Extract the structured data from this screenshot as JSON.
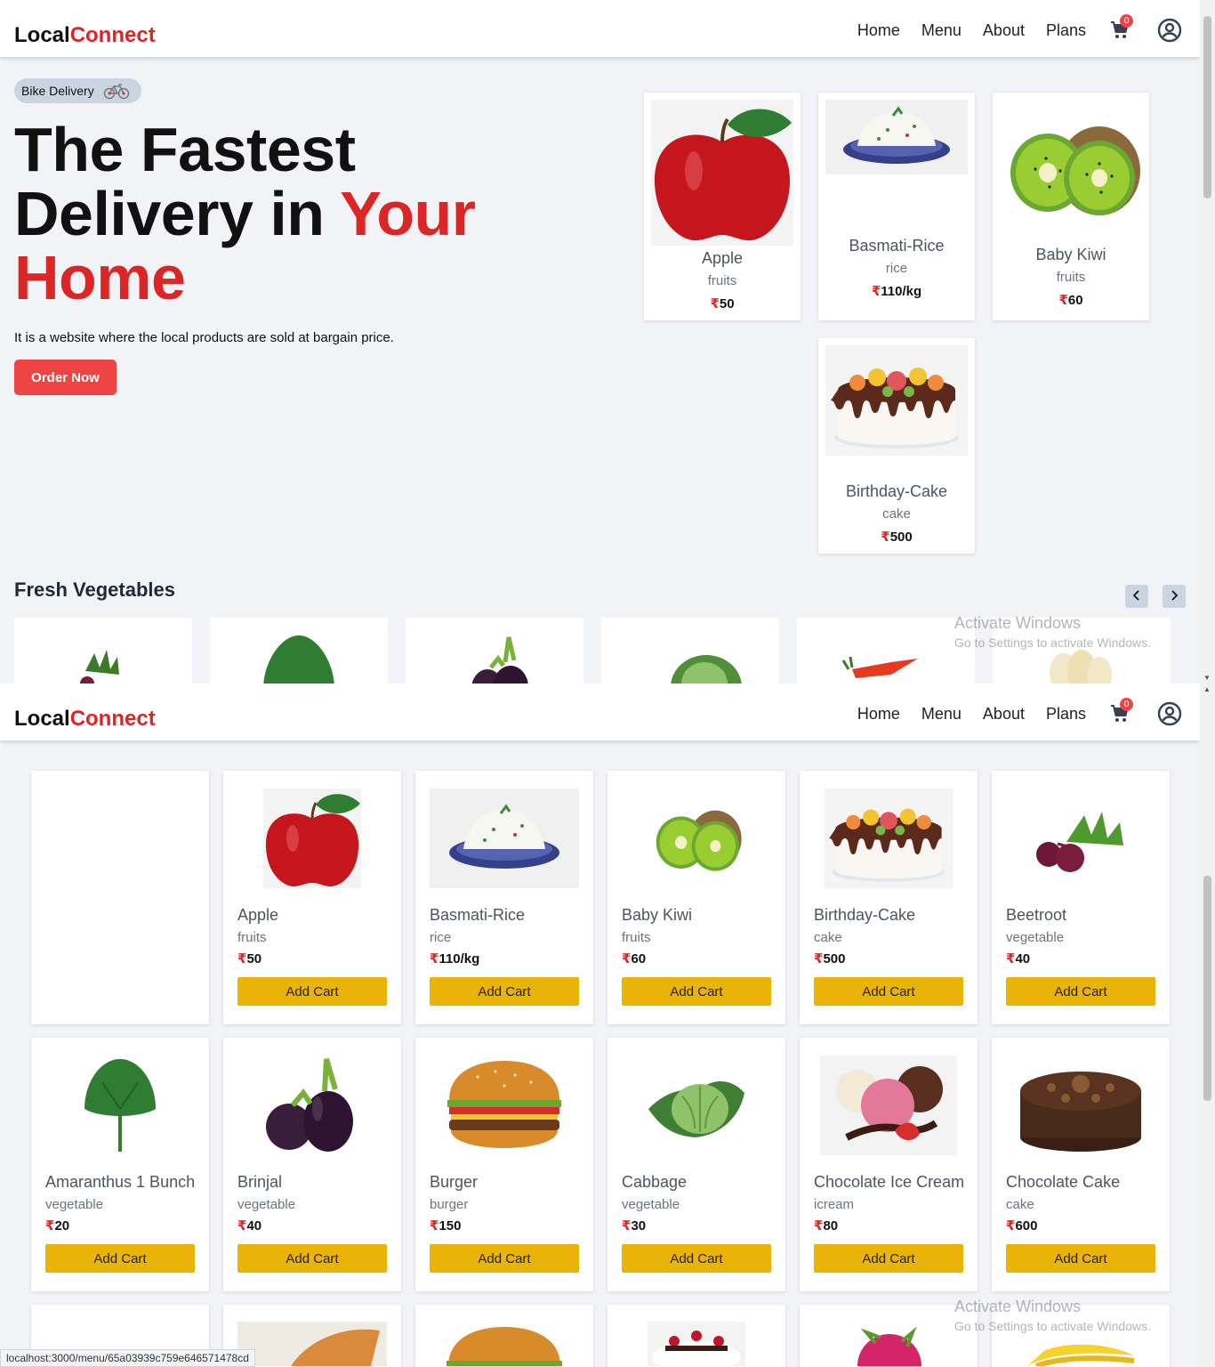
{
  "brand": {
    "part1": "Local",
    "part2": "Connect"
  },
  "nav": {
    "home": "Home",
    "menu": "Menu",
    "about": "About",
    "plans": "Plans",
    "cart_count": "0"
  },
  "hero": {
    "badge": "Bike Delivery",
    "title_line1": "The Fastest",
    "title_line2a": "Delivery in ",
    "title_line2b": "Your",
    "title_line3": "Home",
    "description": "It is a website where the local products are sold at bargain price.",
    "order_button": "Order Now"
  },
  "featured": [
    {
      "name": "Apple",
      "category": "fruits",
      "price": "50",
      "image": "apple"
    },
    {
      "name": "Basmati-Rice",
      "category": "rice",
      "price": "110/kg",
      "image": "rice"
    },
    {
      "name": "Baby Kiwi",
      "category": "fruits",
      "price": "60",
      "image": "kiwi"
    },
    {
      "name": "Birthday-Cake",
      "category": "cake",
      "price": "500",
      "image": "cake"
    }
  ],
  "vegetables_section": {
    "title": "Fresh Vegetables"
  },
  "currency_symbol": "₹",
  "add_cart_label": "Add Cart",
  "menu_items": [
    {
      "name": "Apple",
      "category": "fruits",
      "price": "50",
      "image": "apple"
    },
    {
      "name": "Basmati-Rice",
      "category": "rice",
      "price": "110/kg",
      "image": "rice"
    },
    {
      "name": "Baby Kiwi",
      "category": "fruits",
      "price": "60",
      "image": "kiwi"
    },
    {
      "name": "Birthday-Cake",
      "category": "cake",
      "price": "500",
      "image": "cake"
    },
    {
      "name": "Beetroot",
      "category": "vegetable",
      "price": "40",
      "image": "beetroot"
    },
    {
      "name": "Amaranthus 1 Bunch",
      "category": "vegetable",
      "price": "20",
      "image": "greens"
    },
    {
      "name": "Brinjal",
      "category": "vegetable",
      "price": "40",
      "image": "brinjal"
    },
    {
      "name": "Burger",
      "category": "burger",
      "price": "150",
      "image": "burger"
    },
    {
      "name": "Cabbage",
      "category": "vegetable",
      "price": "30",
      "image": "cabbage"
    },
    {
      "name": "Chocolate Ice Cream",
      "category": "icream",
      "price": "80",
      "image": "icecream"
    },
    {
      "name": "Chocolate Cake",
      "category": "cake",
      "price": "600",
      "image": "chococake"
    }
  ],
  "watermark": {
    "title": "Activate Windows",
    "subtitle": "Go to Settings to activate Windows."
  },
  "status_url": "localhost:3000/menu/65a03939c759e646571478cd",
  "colors": {
    "brand_red": "#dc2626",
    "button_red": "#ef4444",
    "add_cart_yellow": "#eab308",
    "background": "#f1f3f6"
  }
}
